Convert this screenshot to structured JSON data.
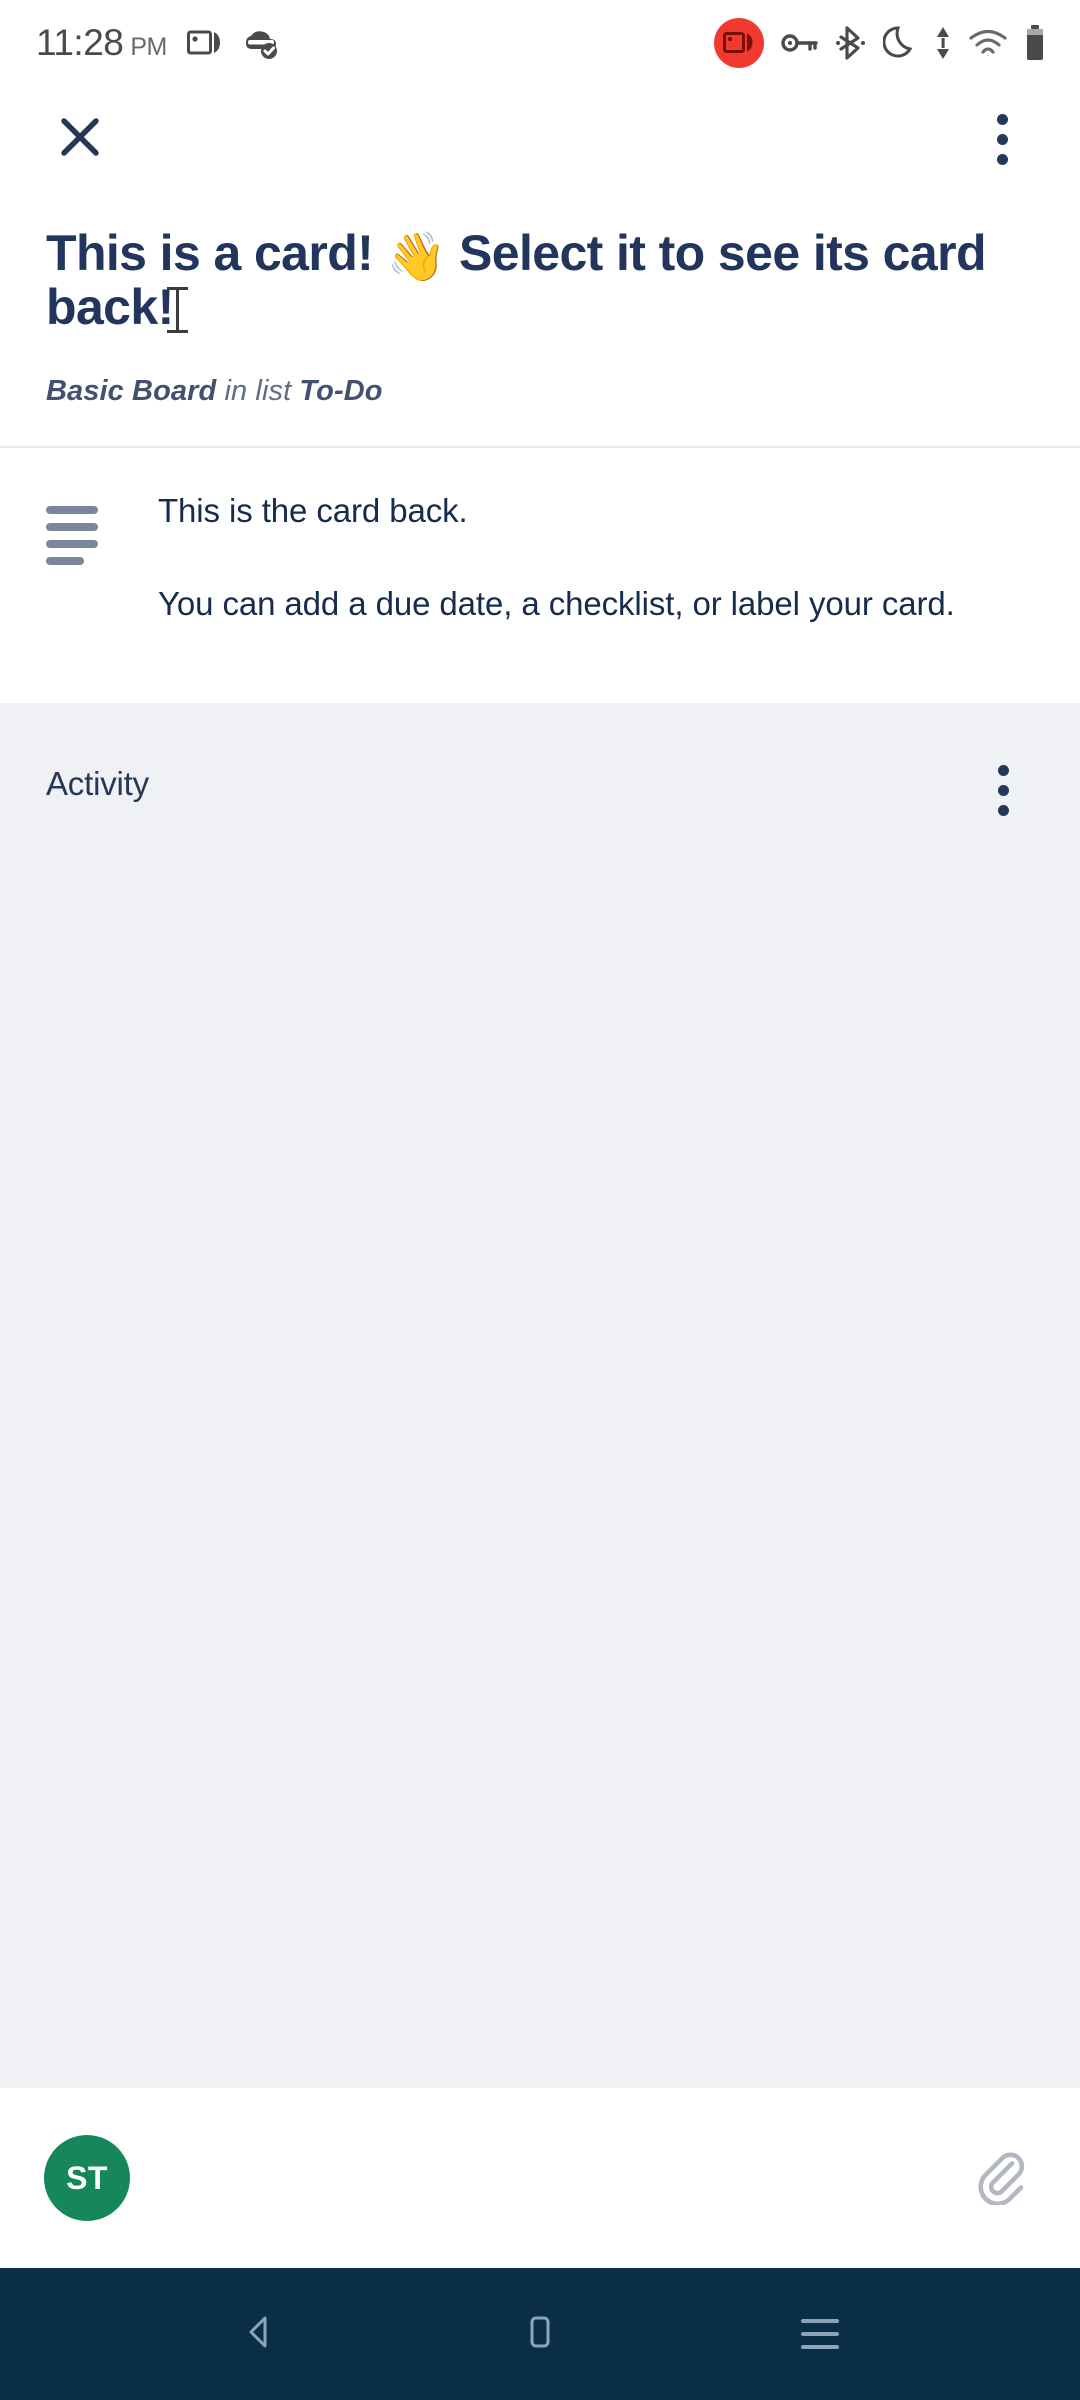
{
  "status_bar": {
    "time": "11:28",
    "ampm": "PM",
    "left_icons": [
      "screen-recorder-icon",
      "backup-complete-icon"
    ],
    "right_icons": [
      "screen-recording-active-icon",
      "vpn-key-icon",
      "bluetooth-icon",
      "do-not-disturb-moon-icon",
      "data-transfer-arrows-icon",
      "wifi-icon",
      "battery-icon"
    ],
    "recording_badge_color": "#f03a2f"
  },
  "app_bar": {
    "close_icon": "close-icon",
    "overflow_icon": "more-vertical-icon"
  },
  "card": {
    "title": "This is a card! 👋 Select it to see its card back!",
    "title_part_1": "This is a card! ",
    "title_emoji": "👋",
    "title_part_2": " Select it to see its card back!",
    "board_name": "Basic Board",
    "in_list_text": " in list ",
    "list_name": "To-Do"
  },
  "description": {
    "icon": "description-lines-icon",
    "paragraph_1": "This is the card back.",
    "paragraph_2": "You can add a due date, a checklist, or label your card."
  },
  "activity": {
    "title": "Activity",
    "overflow_icon": "more-vertical-icon",
    "background_color": "#f0f1f4"
  },
  "comment_bar": {
    "avatar_initials": "ST",
    "avatar_color": "#15875a",
    "attachment_icon": "paperclip-icon"
  },
  "nav_bar": {
    "background_color": "#0b2e47",
    "back_label": "back-icon",
    "home_label": "home-icon",
    "recents_label": "recents-icon"
  },
  "colors": {
    "title_text": "#22355c",
    "body_text": "#172b4d",
    "muted_text": "#5e6c84"
  }
}
